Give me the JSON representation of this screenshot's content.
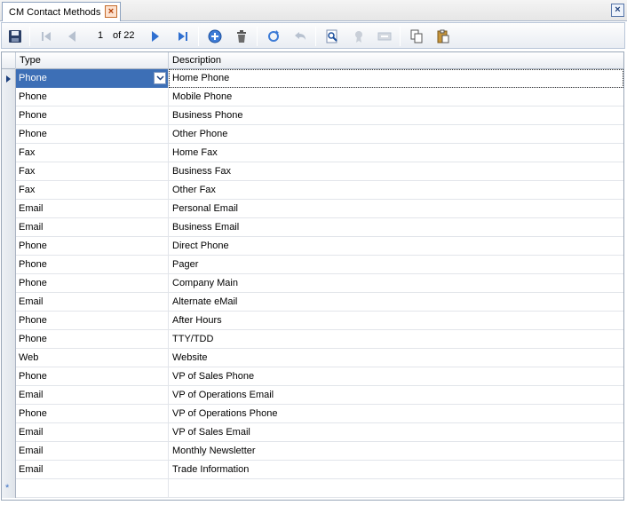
{
  "tab": {
    "title": "CM Contact Methods",
    "close_symbol": "×"
  },
  "window": {
    "close_symbol": "×"
  },
  "navigator": {
    "position": "1",
    "of_label": "of 22"
  },
  "grid": {
    "columns": [
      "Type",
      "Description"
    ],
    "rows": [
      {
        "type": "Phone",
        "description": "Home Phone"
      },
      {
        "type": "Phone",
        "description": "Mobile Phone"
      },
      {
        "type": "Phone",
        "description": "Business Phone"
      },
      {
        "type": "Phone",
        "description": "Other Phone"
      },
      {
        "type": "Fax",
        "description": "Home Fax"
      },
      {
        "type": "Fax",
        "description": "Business Fax"
      },
      {
        "type": "Fax",
        "description": "Other Fax"
      },
      {
        "type": "Email",
        "description": "Personal Email"
      },
      {
        "type": "Email",
        "description": "Business Email"
      },
      {
        "type": "Phone",
        "description": "Direct Phone"
      },
      {
        "type": "Phone",
        "description": "Pager"
      },
      {
        "type": "Phone",
        "description": "Company Main"
      },
      {
        "type": "Email",
        "description": "Alternate eMail"
      },
      {
        "type": "Phone",
        "description": "After Hours"
      },
      {
        "type": "Phone",
        "description": "TTY/TDD"
      },
      {
        "type": "Web",
        "description": "Website"
      },
      {
        "type": "Phone",
        "description": "VP of Sales Phone"
      },
      {
        "type": "Email",
        "description": "VP of Operations Email"
      },
      {
        "type": "Phone",
        "description": "VP of Operations Phone"
      },
      {
        "type": "Email",
        "description": "VP of Sales Email"
      },
      {
        "type": "Email",
        "description": "Monthly Newsletter"
      },
      {
        "type": "Email",
        "description": "Trade Information"
      }
    ],
    "new_row_symbol": "*"
  },
  "icons": {
    "save": "save-icon",
    "first": "first-record-icon",
    "prev": "previous-record-icon",
    "next": "next-record-icon",
    "last": "last-record-icon",
    "add": "add-record-icon",
    "delete": "delete-icon",
    "refresh": "refresh-icon",
    "undo": "undo-icon",
    "find": "find-icon",
    "filter": "filter-icon",
    "form": "form-view-icon",
    "copy": "copy-icon",
    "paste": "paste-icon"
  },
  "colors": {
    "selection": "#3d6fb6",
    "accent": "#1c3f7d",
    "toolbar_border": "#b9c6d8"
  }
}
